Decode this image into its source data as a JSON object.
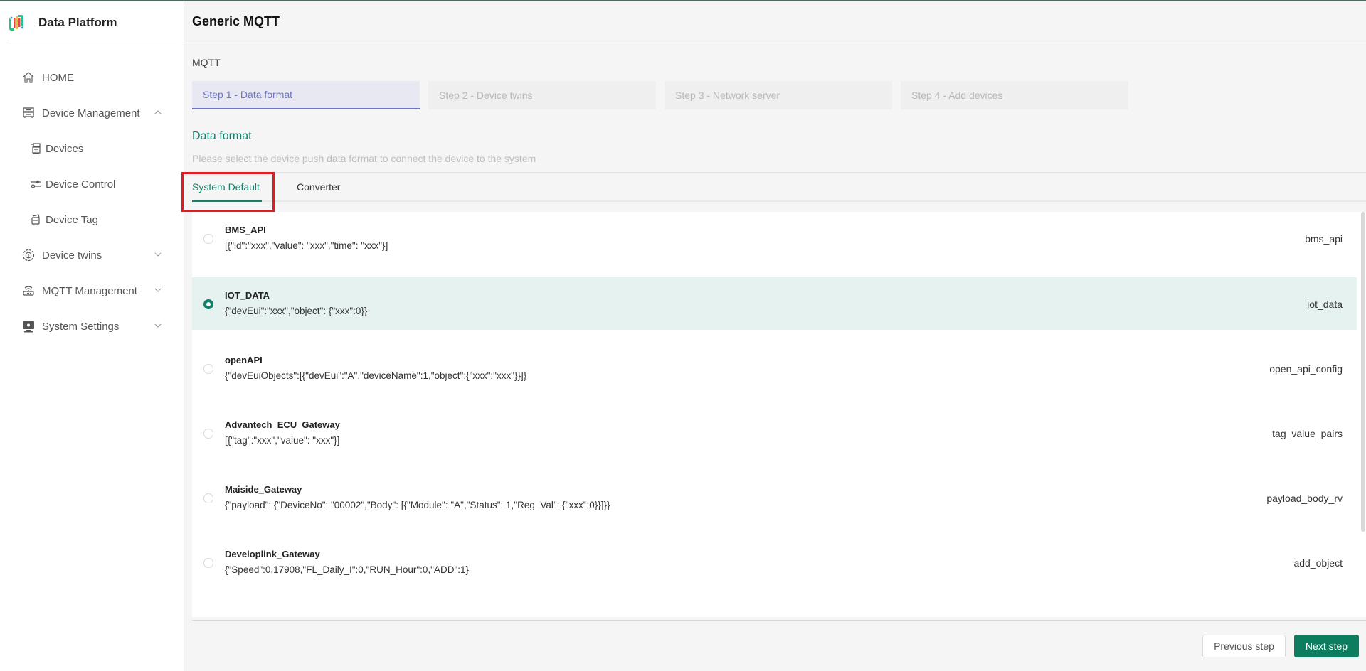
{
  "app": {
    "name": "Data Platform"
  },
  "sidebar": {
    "items": [
      {
        "label": "HOME",
        "icon": "home-icon"
      },
      {
        "label": "Device Management",
        "icon": "server-icon",
        "expanded": true
      },
      {
        "label": "Devices",
        "icon": "devices-icon",
        "sub": true
      },
      {
        "label": "Device Control",
        "icon": "sliders-icon",
        "sub": true
      },
      {
        "label": "Device Tag",
        "icon": "tag-device-icon",
        "sub": true
      },
      {
        "label": "Device twins",
        "icon": "twin-cube-icon",
        "expanded": false
      },
      {
        "label": "MQTT Management",
        "icon": "router-icon",
        "expanded": false
      },
      {
        "label": "System Settings",
        "icon": "monitor-icon",
        "expanded": false
      }
    ]
  },
  "header": {
    "title": "Generic MQTT"
  },
  "breadcrumb": "MQTT",
  "steps": [
    {
      "label": "Step 1 - Data format",
      "active": true
    },
    {
      "label": "Step 2 - Device twins",
      "active": false
    },
    {
      "label": "Step 3 - Network server",
      "active": false
    },
    {
      "label": "Step 4 - Add devices",
      "active": false
    }
  ],
  "section": {
    "title": "Data format",
    "description": "Please select the device push data format to connect the device to the system"
  },
  "tabs": [
    {
      "label": "System Default",
      "active": true
    },
    {
      "label": "Converter",
      "active": false
    }
  ],
  "formats": [
    {
      "name": "BMS_API",
      "format": "[{\"id\":\"xxx\",\"value\":  \"xxx\",\"time\":  \"xxx\"}]",
      "key": "bms_api",
      "selected": false
    },
    {
      "name": "IOT_DATA",
      "format": "{\"devEui\":\"xxx\",\"object\":  {\"xxx\":0}}",
      "key": "iot_data",
      "selected": true
    },
    {
      "name": "openAPI",
      "format": "{\"devEuiObjects\":[{\"devEui\":\"A\",\"deviceName\":1,\"object\":{\"xxx\":\"xxx\"}}]}",
      "key": "open_api_config",
      "selected": false
    },
    {
      "name": "Advantech_ECU_Gateway",
      "format": "[{\"tag\":\"xxx\",\"value\":  \"xxx\"}]",
      "key": "tag_value_pairs",
      "selected": false
    },
    {
      "name": "Maiside_Gateway",
      "format": "{\"payload\": {\"DeviceNo\": \"00002\",\"Body\": [{\"Module\": \"A\",\"Status\": 1,\"Reg_Val\": {\"xxx\":0}}]}}",
      "key": "payload_body_rv",
      "selected": false
    },
    {
      "name": "Developlink_Gateway",
      "format": "{\"Speed\":0.17908,\"FL_Daily_I\":0,\"RUN_Hour\":0,\"ADD\":1}",
      "key": "add_object",
      "selected": false
    }
  ],
  "footer": {
    "previous_label": "Previous step",
    "next_label": "Next step"
  },
  "colors": {
    "accent": "#12806a",
    "step_active": "#6b74c8",
    "selected_row": "#e6f2ef",
    "highlight_box": "#e21b23"
  }
}
